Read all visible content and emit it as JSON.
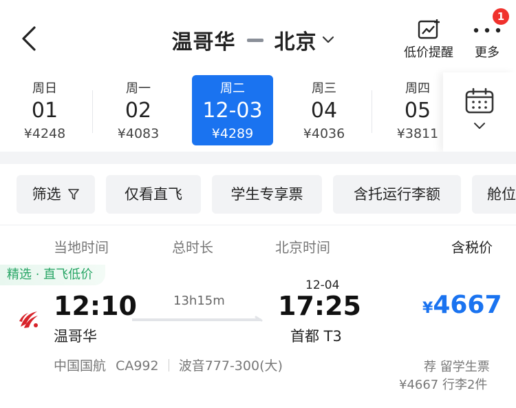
{
  "header": {
    "from_city": "温哥华",
    "to_city": "北京",
    "price_alert_label": "低价提醒",
    "more_label": "更多",
    "badge_count": "1"
  },
  "dates": [
    {
      "weekday": "周日",
      "day": "01",
      "price": "¥4248",
      "selected": false
    },
    {
      "weekday": "周一",
      "day": "02",
      "price": "¥4083",
      "selected": false
    },
    {
      "weekday": "周二",
      "day": "12-03",
      "price": "¥4289",
      "selected": true
    },
    {
      "weekday": "周三",
      "day": "04",
      "price": "¥4036",
      "selected": false
    },
    {
      "weekday": "周四",
      "day": "05",
      "price": "¥3811",
      "selected": false
    }
  ],
  "filters": [
    "筛选",
    "仅看直飞",
    "学生专享票",
    "含托运行李额",
    "舱位"
  ],
  "columns": {
    "local_time": "当地时间",
    "duration": "总时长",
    "beijing_time": "北京时间",
    "price_incl_tax": "含税价"
  },
  "flight": {
    "tag": "精选 · 直飞低价",
    "dep_time": "12:10",
    "dep_city": "温哥华",
    "duration": "13h15m",
    "arr_date": "12-04",
    "arr_time": "17:25",
    "arr_terminal": "首都 T3",
    "price_currency": "¥",
    "price": "4667",
    "airline": "中国国航",
    "flight_no": "CA992",
    "aircraft": "波音777-300(大)",
    "recommend": "荐 留学生票",
    "extra": "¥4667 行李2件"
  },
  "colors": {
    "accent": "#1a73f0",
    "badge": "#f0312c",
    "tag_green": "#27a565",
    "airline_red": "#d8232a"
  },
  "icons": {
    "back": "chevron-left-icon",
    "route_dropdown": "chevron-down-icon",
    "price_alert": "trend-chart-icon",
    "more": "more-dots-icon",
    "calendar": "calendar-icon",
    "filter": "filter-funnel-icon",
    "airline": "air-china-logo-icon"
  }
}
